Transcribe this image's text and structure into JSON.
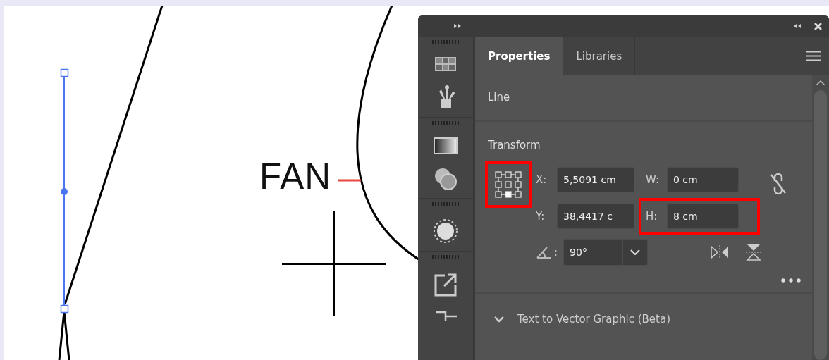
{
  "canvas": {
    "label": "FAN"
  },
  "panel": {
    "tabs": [
      {
        "label": "Properties",
        "selected": true
      },
      {
        "label": "Libraries",
        "selected": false
      }
    ],
    "selection_type": "Line",
    "transform": {
      "title": "Transform",
      "reference_point_highlighted": true,
      "fields": [
        {
          "label": "X:",
          "value": "5,5091 cm",
          "highlighted": false
        },
        {
          "label": "W:",
          "value": "0 cm",
          "highlighted": false
        },
        {
          "label": "Y:",
          "value": "38,4417 c",
          "highlighted": false
        },
        {
          "label": "H:",
          "value": "8 cm",
          "highlighted": true
        }
      ],
      "angle": {
        "label": ":",
        "value": "90°"
      }
    },
    "sections": [
      {
        "title": "Text to Vector Graphic (Beta)",
        "expanded": false
      }
    ]
  }
}
